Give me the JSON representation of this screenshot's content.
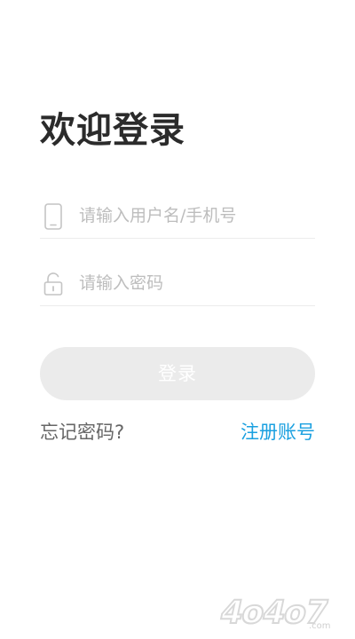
{
  "page": {
    "title": "欢迎登录"
  },
  "form": {
    "username": {
      "placeholder": "请输入用户名/手机号",
      "value": "",
      "icon": "phone-icon"
    },
    "password": {
      "placeholder": "请输入密码",
      "value": "",
      "icon": "lock-icon"
    },
    "login_label": "登录"
  },
  "links": {
    "forgot_password": "忘记密码?",
    "register": "注册账号"
  },
  "watermark": {
    "text": "4o4o7",
    "suffix": ".com"
  },
  "colors": {
    "title": "#2b2b2b",
    "placeholder": "#bdbdbd",
    "divider": "#ececec",
    "button_bg": "#ebebeb",
    "button_text": "#ffffff",
    "link_gray": "#666666",
    "link_blue": "#1aa0e0"
  }
}
